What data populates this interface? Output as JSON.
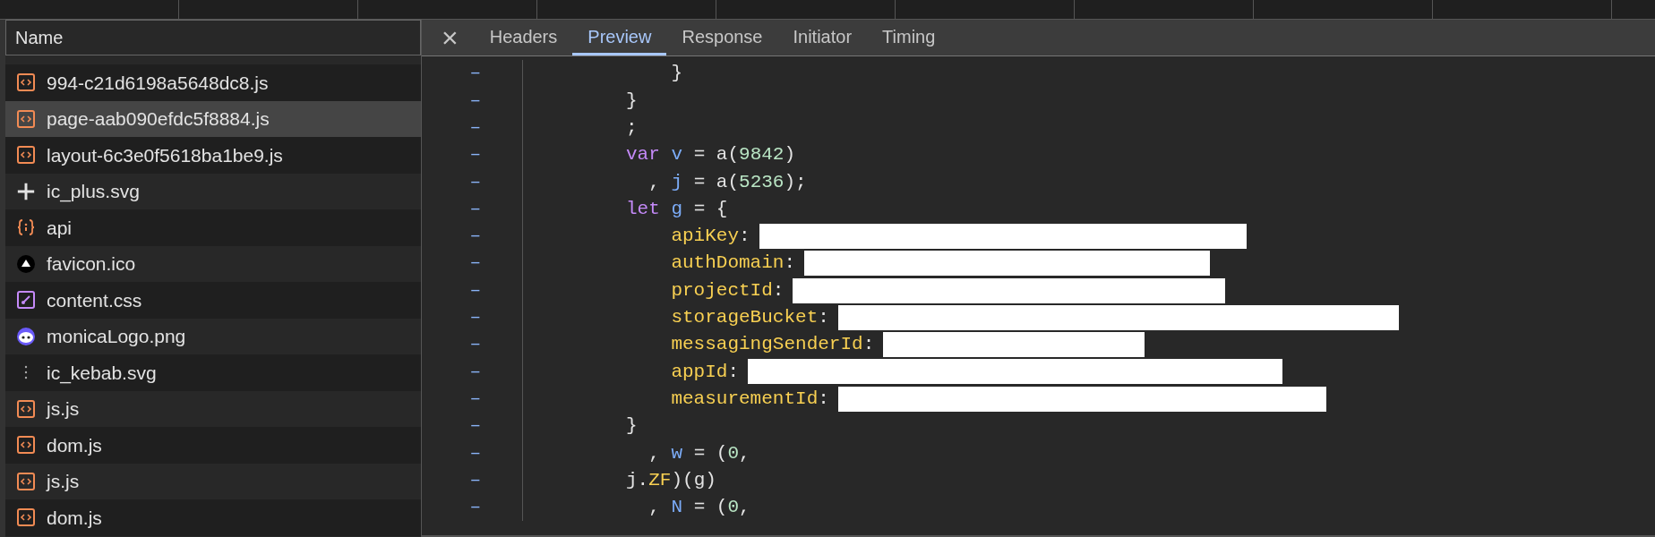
{
  "requests": {
    "header": "Name",
    "rows": [
      {
        "name": "994-c21d6198a5648dc8.js",
        "kind": "script",
        "selected": false
      },
      {
        "name": "page-aab090efdc5f8884.js",
        "kind": "script",
        "selected": true
      },
      {
        "name": "layout-6c3e0f5618ba1be9.js",
        "kind": "script",
        "selected": false
      },
      {
        "name": "ic_plus.svg",
        "kind": "plus",
        "selected": false
      },
      {
        "name": "api",
        "kind": "json",
        "selected": false
      },
      {
        "name": "favicon.ico",
        "kind": "favicon",
        "selected": false
      },
      {
        "name": "content.css",
        "kind": "stylesheet",
        "selected": false
      },
      {
        "name": "monicaLogo.png",
        "kind": "logo",
        "selected": false
      },
      {
        "name": "ic_kebab.svg",
        "kind": "kebab",
        "selected": false
      },
      {
        "name": "js.js",
        "kind": "script",
        "selected": false
      },
      {
        "name": "dom.js",
        "kind": "script",
        "selected": false
      },
      {
        "name": "js.js",
        "kind": "script",
        "selected": false
      },
      {
        "name": "dom.js",
        "kind": "script",
        "selected": false
      }
    ]
  },
  "detail": {
    "close": "×",
    "tabs": [
      {
        "label": "Headers",
        "selected": false
      },
      {
        "label": "Preview",
        "selected": true
      },
      {
        "label": "Response",
        "selected": false
      },
      {
        "label": "Initiator",
        "selected": false
      },
      {
        "label": "Timing",
        "selected": false
      }
    ],
    "lines": [
      {
        "gutter": "–",
        "tokens": [
          {
            "text": "    }",
            "kind": "punct"
          }
        ]
      },
      {
        "gutter": "–",
        "tokens": [
          {
            "text": "}",
            "kind": "punct"
          }
        ]
      },
      {
        "gutter": "–",
        "tokens": [
          {
            "text": ";",
            "kind": "punct"
          }
        ]
      },
      {
        "gutter": "–",
        "tokens": [
          {
            "text": "var",
            "kind": "keyword"
          },
          {
            "text": " v",
            "kind": "variable"
          },
          {
            "text": " = a(",
            "kind": "punct"
          },
          {
            "text": "9842",
            "kind": "number"
          },
          {
            "text": ")",
            "kind": "punct"
          }
        ]
      },
      {
        "gutter": "–",
        "tokens": [
          {
            "text": "  , ",
            "kind": "punct"
          },
          {
            "text": "j",
            "kind": "variable"
          },
          {
            "text": " = a(",
            "kind": "punct"
          },
          {
            "text": "5236",
            "kind": "number"
          },
          {
            "text": ");",
            "kind": "punct"
          }
        ]
      },
      {
        "gutter": "–",
        "tokens": [
          {
            "text": "let",
            "kind": "keyword"
          },
          {
            "text": " g",
            "kind": "variable"
          },
          {
            "text": " = {",
            "kind": "punct"
          }
        ]
      },
      {
        "gutter": "–",
        "tokens": [
          {
            "text": "    apiKey",
            "kind": "property"
          },
          {
            "text": ":",
            "kind": "punct"
          }
        ],
        "redacted": true
      },
      {
        "gutter": "–",
        "tokens": [
          {
            "text": "    authDomain",
            "kind": "property"
          },
          {
            "text": ":",
            "kind": "punct"
          }
        ],
        "redacted": true
      },
      {
        "gutter": "–",
        "tokens": [
          {
            "text": "    projectId",
            "kind": "property"
          },
          {
            "text": ":",
            "kind": "punct"
          }
        ],
        "redacted": true
      },
      {
        "gutter": "–",
        "tokens": [
          {
            "text": "    storageBucket",
            "kind": "property"
          },
          {
            "text": ":",
            "kind": "punct"
          }
        ],
        "redacted": true
      },
      {
        "gutter": "–",
        "tokens": [
          {
            "text": "    messagingSenderId",
            "kind": "property"
          },
          {
            "text": ":",
            "kind": "punct"
          }
        ],
        "redacted": true
      },
      {
        "gutter": "–",
        "tokens": [
          {
            "text": "    appId",
            "kind": "property"
          },
          {
            "text": ":",
            "kind": "punct"
          }
        ],
        "redacted": true
      },
      {
        "gutter": "–",
        "tokens": [
          {
            "text": "    measurementId",
            "kind": "property"
          },
          {
            "text": ":",
            "kind": "punct"
          }
        ],
        "redacted": true
      },
      {
        "gutter": "–",
        "tokens": [
          {
            "text": "}",
            "kind": "punct"
          }
        ]
      },
      {
        "gutter": "–",
        "tokens": [
          {
            "text": "  , ",
            "kind": "punct"
          },
          {
            "text": "w",
            "kind": "variable"
          },
          {
            "text": " = (",
            "kind": "punct"
          },
          {
            "text": "0",
            "kind": "number"
          },
          {
            "text": ",",
            "kind": "punct"
          }
        ]
      },
      {
        "gutter": "–",
        "tokens": [
          {
            "text": "j.",
            "kind": "punct"
          },
          {
            "text": "ZF",
            "kind": "property"
          },
          {
            "text": ")(g)",
            "kind": "punct"
          }
        ]
      },
      {
        "gutter": "–",
        "tokens": [
          {
            "text": "  , ",
            "kind": "punct"
          },
          {
            "text": "N",
            "kind": "variable"
          },
          {
            "text": " = (",
            "kind": "punct"
          },
          {
            "text": "0",
            "kind": "number"
          },
          {
            "text": ",",
            "kind": "punct"
          }
        ]
      }
    ]
  }
}
